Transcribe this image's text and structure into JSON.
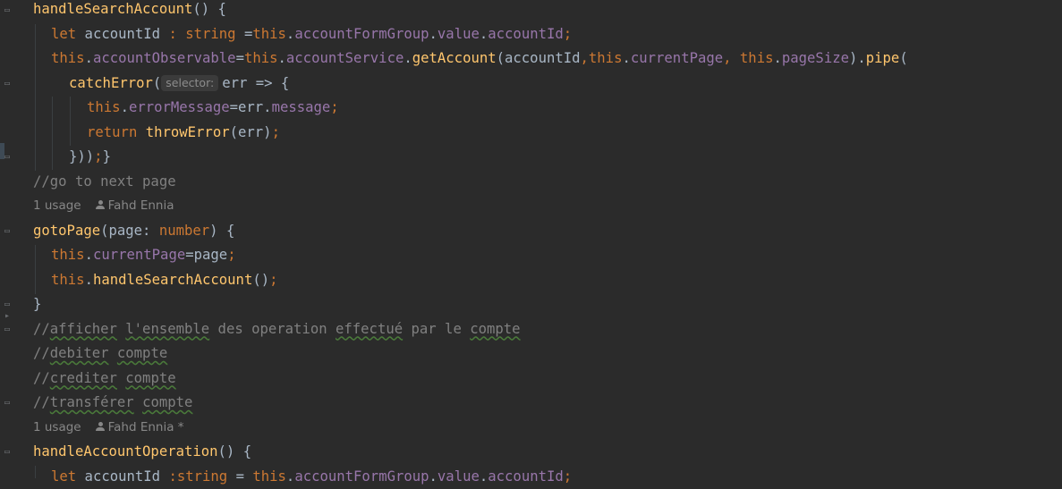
{
  "code": {
    "l1": {
      "name": "handleSearchAccount",
      "rest": "() {"
    },
    "l2": {
      "kw": "let",
      "var": " accountId ",
      "colon": ": ",
      "type": "string",
      "assign": " =",
      "this": "this",
      "dot1": ".",
      "fld1": "accountFormGroup",
      "dot2": ".",
      "fld2": "value",
      "dot3": ".",
      "fld3": "accountId",
      "semi": ";"
    },
    "l3": {
      "this1": "this",
      "dot1": ".",
      "fld1": "accountObservable",
      "eq": "=",
      "this2": "this",
      "dot2": ".",
      "fld2": "accountService",
      "dot3": ".",
      "fn": "getAccount",
      "p1": "(accountId",
      "comma1": ",",
      "this3": "this",
      "dot4": ".",
      "fld3": "currentPage",
      "comma2": ", ",
      "this4": "this",
      "dot5": ".",
      "fld4": "pageSize",
      "p2": ").",
      "fn2": "pipe",
      "p3": "("
    },
    "l4": {
      "fn": "catchError",
      "p": "(",
      "hint": "selector:",
      "rest": "err => {"
    },
    "l5": {
      "this": "this",
      "dot": ".",
      "fld": "errorMessage",
      "eq": "=err.",
      "fld2": "message",
      "semi": ";"
    },
    "l6": {
      "kw": "return ",
      "fn": "throwError",
      "rest": "(err)",
      "semi": ";"
    },
    "l7": {
      "a": "}))",
      "semi": ";",
      "b": "}"
    },
    "l8": {
      "text": "//go to next page"
    },
    "l9": {
      "usages": "1 usage",
      "author": "Fahd Ennia"
    },
    "l10": {
      "fn": "gotoPage",
      "a": "(page: ",
      "type": "number",
      "b": ") {"
    },
    "l11": {
      "this": "this",
      "dot": ".",
      "fld": "currentPage",
      "eq": "=page",
      "semi": ";"
    },
    "l12": {
      "this": "this",
      "dot": ".",
      "fn": "handleSearchAccount",
      "rest": "()",
      "semi": ";"
    },
    "l13": {
      "text": "}"
    },
    "l14": {
      "c1": "//",
      "w1": "afficher",
      "sp1": " ",
      "w2": "l'ensemble",
      "c2": " des operation ",
      "w3": "effectué",
      "c3": " par le ",
      "w4": "compte"
    },
    "l15": {
      "c1": "//",
      "w1": "debiter",
      "sp": " ",
      "w2": "compte"
    },
    "l16": {
      "c1": "//",
      "w1": "crediter",
      "sp": " ",
      "w2": "compte"
    },
    "l17": {
      "c1": "//",
      "w1": "transférer",
      "sp": " ",
      "w2": "compte"
    },
    "l18": {
      "usages": "1 usage",
      "author": "Fahd Ennia *"
    },
    "l19": {
      "fn": "handleAccountOperation",
      "rest": "() {"
    },
    "l20": {
      "kw": "let",
      "var": " accountId ",
      "colon": ":",
      "type": "string",
      "assign": " = ",
      "this": "this",
      "dot1": ".",
      "fld1": "accountFormGroup",
      "dot2": ".",
      "fld2": "value",
      "dot3": ".",
      "fld3": "accountId",
      "semi": ";"
    }
  },
  "colors": {
    "background": "#2b2b2b",
    "function": "#ffc66d",
    "keyword": "#cc7832",
    "field": "#9876aa",
    "comment": "#808080",
    "plain": "#a9b7c6"
  }
}
